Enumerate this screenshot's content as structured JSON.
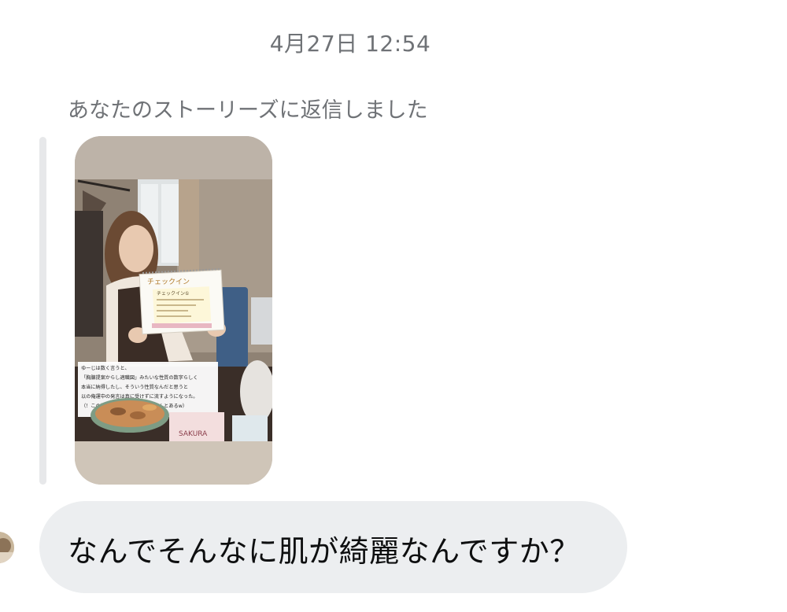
{
  "conversation": {
    "timestamp": "4月27日 12:54",
    "story_reply_label": "あなたのストーリーズに返信しました",
    "message": "なんでそんなに肌が綺麗なんですか？"
  },
  "story": {
    "board_title": "チェックイン",
    "board_subtitle": "チェックイン①",
    "caption_lines": [
      "ゆーじは数く言うと、",
      "「胸腺提案からし適職図」みたいな性質の数字らしく",
      "本当に納得したし、そういう性質なんだと思うと",
      "以の俺運中の発言は真に受けずに流すようになった。",
      "（！この数字のいいところももちゃんとあるw）"
    ],
    "bag_text": "SAKURA"
  },
  "colors": {
    "background": "#ffffff",
    "meta_text": "#6f7276",
    "bubble": "#eceef0",
    "reply_bar": "#e7e8ea",
    "message_text": "#0e0f10"
  }
}
